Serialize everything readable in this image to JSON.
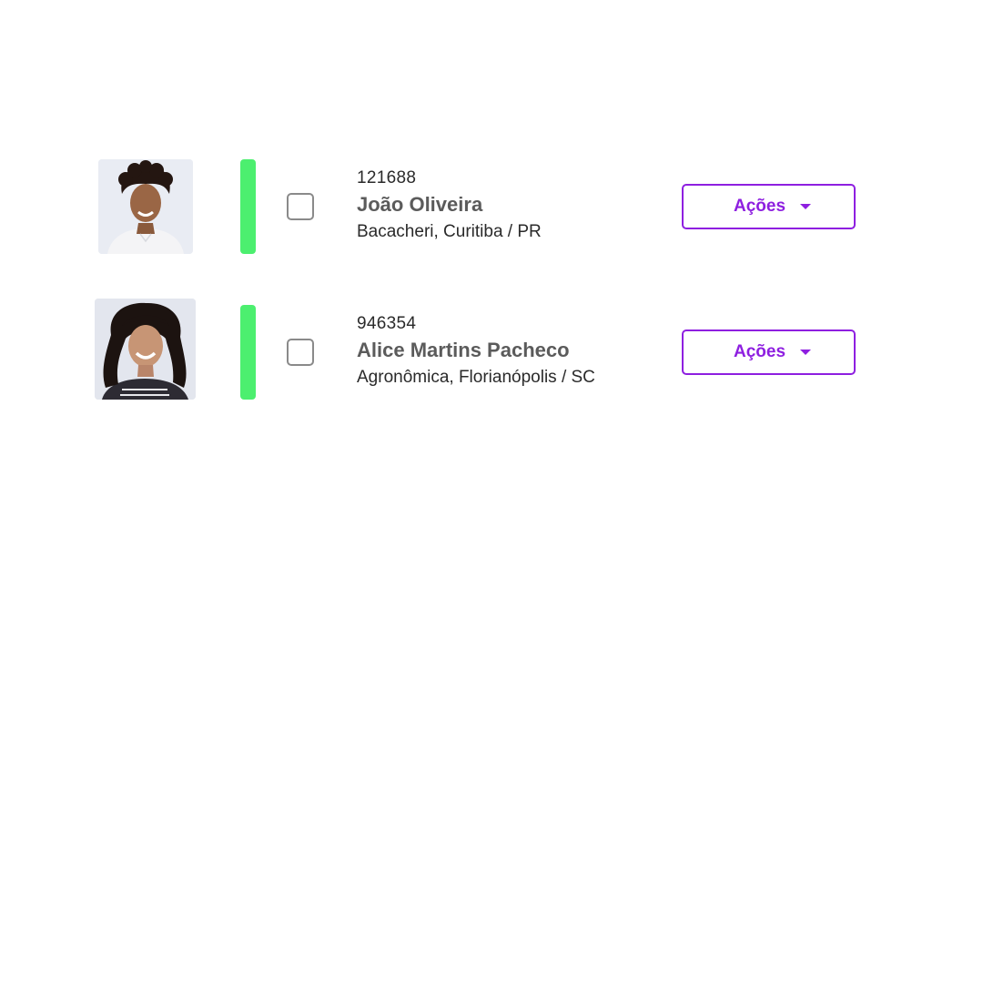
{
  "people": [
    {
      "id": "121688",
      "name": "João Oliveira",
      "location": "Bacacheri, Curitiba / PR",
      "action_label": "Ações",
      "status_color": "#4cef6f",
      "avatar_icon": "person-photo-man"
    },
    {
      "id": "946354",
      "name": "Alice Martins Pacheco",
      "location": "Agronômica, Florianópolis / SC",
      "action_label": "Ações",
      "status_color": "#4cef6f",
      "avatar_icon": "person-photo-woman"
    }
  ],
  "colors": {
    "accent": "#8e1fe0",
    "status_active": "#4cef6f",
    "name_text": "#5b5b5b",
    "body_text": "#2a2a2a"
  }
}
